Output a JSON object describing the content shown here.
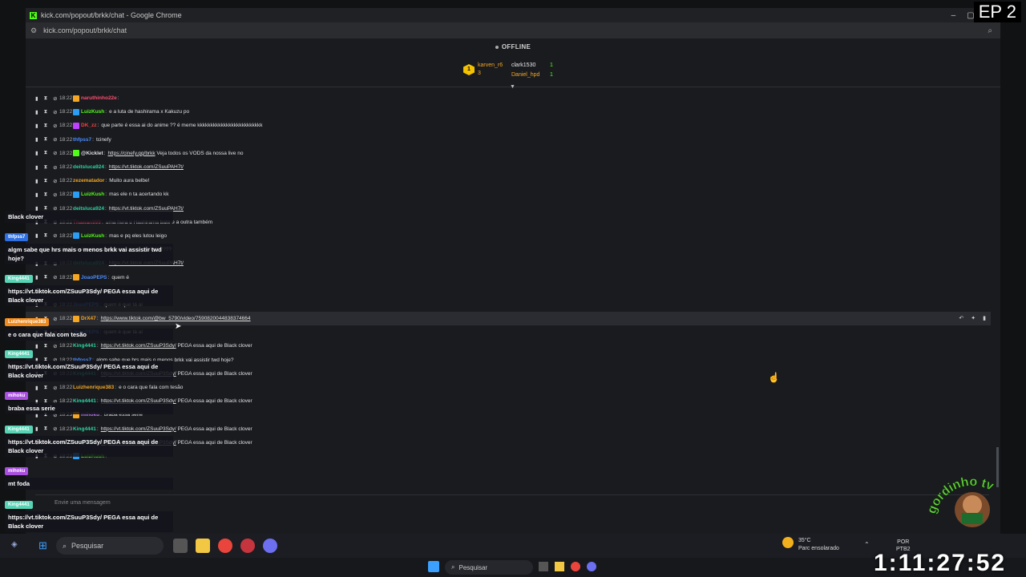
{
  "window": {
    "title": "kick.com/popout/brkk/chat - Google Chrome",
    "url": "kick.com/popout/brkk/chat"
  },
  "stream": {
    "status": "OFFLINE"
  },
  "pinned": {
    "user1": "karven_r6",
    "count1": "3",
    "user2": "clark1530",
    "count2": "1",
    "user3": "Daniel_hpd",
    "count3": "1"
  },
  "colors": {
    "kick_green": "#53fc18",
    "gold": "#f5c200"
  },
  "chat": [
    {
      "time": "18:22",
      "user": "naruthinho22e",
      "color": "#ff4d6d",
      "text": "",
      "link": "",
      "badge": "#f5a623"
    },
    {
      "time": "18:22",
      "user": "LuizKush",
      "color": "#53fc18",
      "text": "e a luta de hashirama x Kakuzu po",
      "link": "",
      "badge": "#2a9df4"
    },
    {
      "time": "18:22",
      "user": "DK_zz",
      "color": "#ff3d3d",
      "text": "que parte é essa ai do anime ?? é meme kkkkkkkkkkkkkkkkkkkkkkkkk",
      "link": "",
      "badge": "#c040ff"
    },
    {
      "time": "18:22",
      "user": "thfpss7",
      "color": "#4a8cff",
      "text": "tcinefy",
      "link": "",
      "badge": ""
    },
    {
      "time": "18:22",
      "user": "@Kicklet",
      "color": "#e0e0e0",
      "text": "Veja todos os VODS da nossa live no",
      "link": "https://cinefy.gg/brkk",
      "badge": "#53fc18"
    },
    {
      "time": "18:22",
      "user": "deitsluca924",
      "color": "#2fd2a0",
      "text": "",
      "link": "https://vt.tiktok.com/ZSuuPAH7t/",
      "badge": ""
    },
    {
      "time": "18:22",
      "user": "zezematador",
      "color": "#f5a623",
      "text": "Muito aura belbe!",
      "link": "",
      "badge": ""
    },
    {
      "time": "18:22",
      "user": "LuizKush",
      "color": "#53fc18",
      "text": "mas ele n ta acertando kk",
      "link": "",
      "badge": "#2a9df4"
    },
    {
      "time": "18:22",
      "user": "deitsluca924",
      "color": "#2fd2a0",
      "text": "",
      "link": "https://vt.tiktok.com/ZSuuPAH7t/",
      "badge": ""
    },
    {
      "time": "18:22",
      "user": "Thawan999",
      "color": "#ff4d6d",
      "text": "uma hora o Hashirama bate e a outra também",
      "link": "",
      "badge": ""
    },
    {
      "time": "18:22",
      "user": "LuizKush",
      "color": "#53fc18",
      "text": "mas e pq eles lutou leigo",
      "link": "",
      "badge": "#2a9df4"
    },
    {
      "time": "18:22",
      "user": "",
      "color": "#e0e0e0",
      "text": "se ele vai assistir mais um de TWD??????",
      "link": "",
      "badge": ""
    },
    {
      "time": "18:22",
      "user": "deitsluca924",
      "color": "#2fd2a0",
      "text": "",
      "link": "https://vt.tiktok.com/ZSuuPAH7t/",
      "badge": ""
    },
    {
      "time": "18:22",
      "user": "JoaoPEPS",
      "color": "#4a8cff",
      "text": "quem é",
      "link": "",
      "badge": "#f5a623"
    },
    {
      "time": "18:22",
      "user": "",
      "color": "#e0e0e0",
      "text": "toma banho volta só 1",
      "link": "",
      "badge": ""
    },
    {
      "time": "18:22",
      "user": "JoaoPEPS",
      "color": "#4a8cff",
      "text": "quem é que tá aí",
      "link": "",
      "badge": ""
    },
    {
      "time": "18:22",
      "user": "DrX47",
      "color": "#f5a623",
      "text": "",
      "link": "https://www.tiktok.com/@bw_5790/video/7590820044838374664",
      "badge": "#f5a623",
      "hl": true
    },
    {
      "time": "18:22",
      "user": "JoaoPEPS",
      "color": "#4a8cff",
      "text": "quem é que tá aí",
      "link": "",
      "badge": ""
    },
    {
      "time": "18:22",
      "user": "King4441",
      "color": "#2fd2a0",
      "text": "PEGA essa aqui de Black clover",
      "link": "https://vt.tiktok.com/ZSuuP3Sdy/",
      "badge": ""
    },
    {
      "time": "18:22",
      "user": "thfpss7",
      "color": "#4a8cff",
      "text": "algm sabe que hrs mais o menos brkk vai assistir twd hoje?",
      "link": "",
      "badge": ""
    },
    {
      "time": "18:22",
      "user": "King4441",
      "color": "#2fd2a0",
      "text": "PEGA essa aqui de Black clover",
      "link": "https://vt.tiktok.com/ZSuuP3Sdy/",
      "badge": ""
    },
    {
      "time": "18:22",
      "user": "Luizhenrique383",
      "color": "#f5a623",
      "text": "e o cara que fala com tesão",
      "link": "",
      "badge": ""
    },
    {
      "time": "18:22",
      "user": "King4441",
      "color": "#2fd2a0",
      "text": "PEGA essa aqui de Black clover",
      "link": "https://vt.tiktok.com/ZSuuP3Sdy/",
      "badge": ""
    },
    {
      "time": "18:23",
      "user": "mihoku",
      "color": "#c47dff",
      "text": "braba essa serie",
      "link": "",
      "badge": "#f5a623"
    },
    {
      "time": "18:23",
      "user": "King4441",
      "color": "#2fd2a0",
      "text": "PEGA essa aqui de Black clover",
      "link": "https://vt.tiktok.com/ZSuuP3Sdy/",
      "badge": ""
    },
    {
      "time": "18:23",
      "user": "King4441",
      "color": "#2fd2a0",
      "text": "PEGA essa aqui de Black clover",
      "link": "https://vt.tiktok.com/ZSuuP3Sdy/",
      "badge": ""
    },
    {
      "time": "18:23",
      "user": "LuizKush",
      "color": "#53fc18",
      "text": "",
      "link": "",
      "badge": "#2a9df4"
    }
  ],
  "input": {
    "placeholder": "Envie uma mensagem"
  },
  "overlay": [
    {
      "user": "",
      "text": "Black clover",
      "color": "#3a3a3a"
    },
    {
      "user": "thfpss7",
      "text": "algm sabe que hrs mais o menos brkk vai assistir twd hoje?",
      "color": "#2f6fe0"
    },
    {
      "user": "King4441",
      "text": "https://vt.tiktok.com/ZSuuP3Sdy/ PEGA essa aqui de Black clover",
      "color": "#56d4b5"
    },
    {
      "user": "Luizhenrique383",
      "text": "e o cara que fala com tesão",
      "color": "#f08a1c"
    },
    {
      "user": "King4441",
      "text": "https://vt.tiktok.com/ZSuuP3Sdy/ PEGA essa aqui de Black clover",
      "color": "#56d4b5"
    },
    {
      "user": "mihoku",
      "text": "braba essa serie",
      "color": "#a94fe0"
    },
    {
      "user": "King4441",
      "text": "https://vt.tiktok.com/ZSuuP3Sdy/ PEGA essa aqui de Black clover",
      "color": "#56d4b5"
    },
    {
      "user": "mihoku",
      "text": "mt foda",
      "color": "#a94fe0"
    },
    {
      "user": "King4441",
      "text": "https://vt.tiktok.com/ZSuuP3Sdy/ PEGA essa aqui de Black clover",
      "color": "#56d4b5"
    }
  ],
  "taskbar": {
    "search": "Pesquisar",
    "weather_temp": "35°C",
    "weather_desc": "Parc ensolarado",
    "lang1": "POR",
    "lang2": "PTB2"
  },
  "taskbar2": {
    "search": "Pesquisar"
  },
  "episode": "EP 2",
  "timer": "1:11:27:52",
  "logo_text": "gordinho tv"
}
